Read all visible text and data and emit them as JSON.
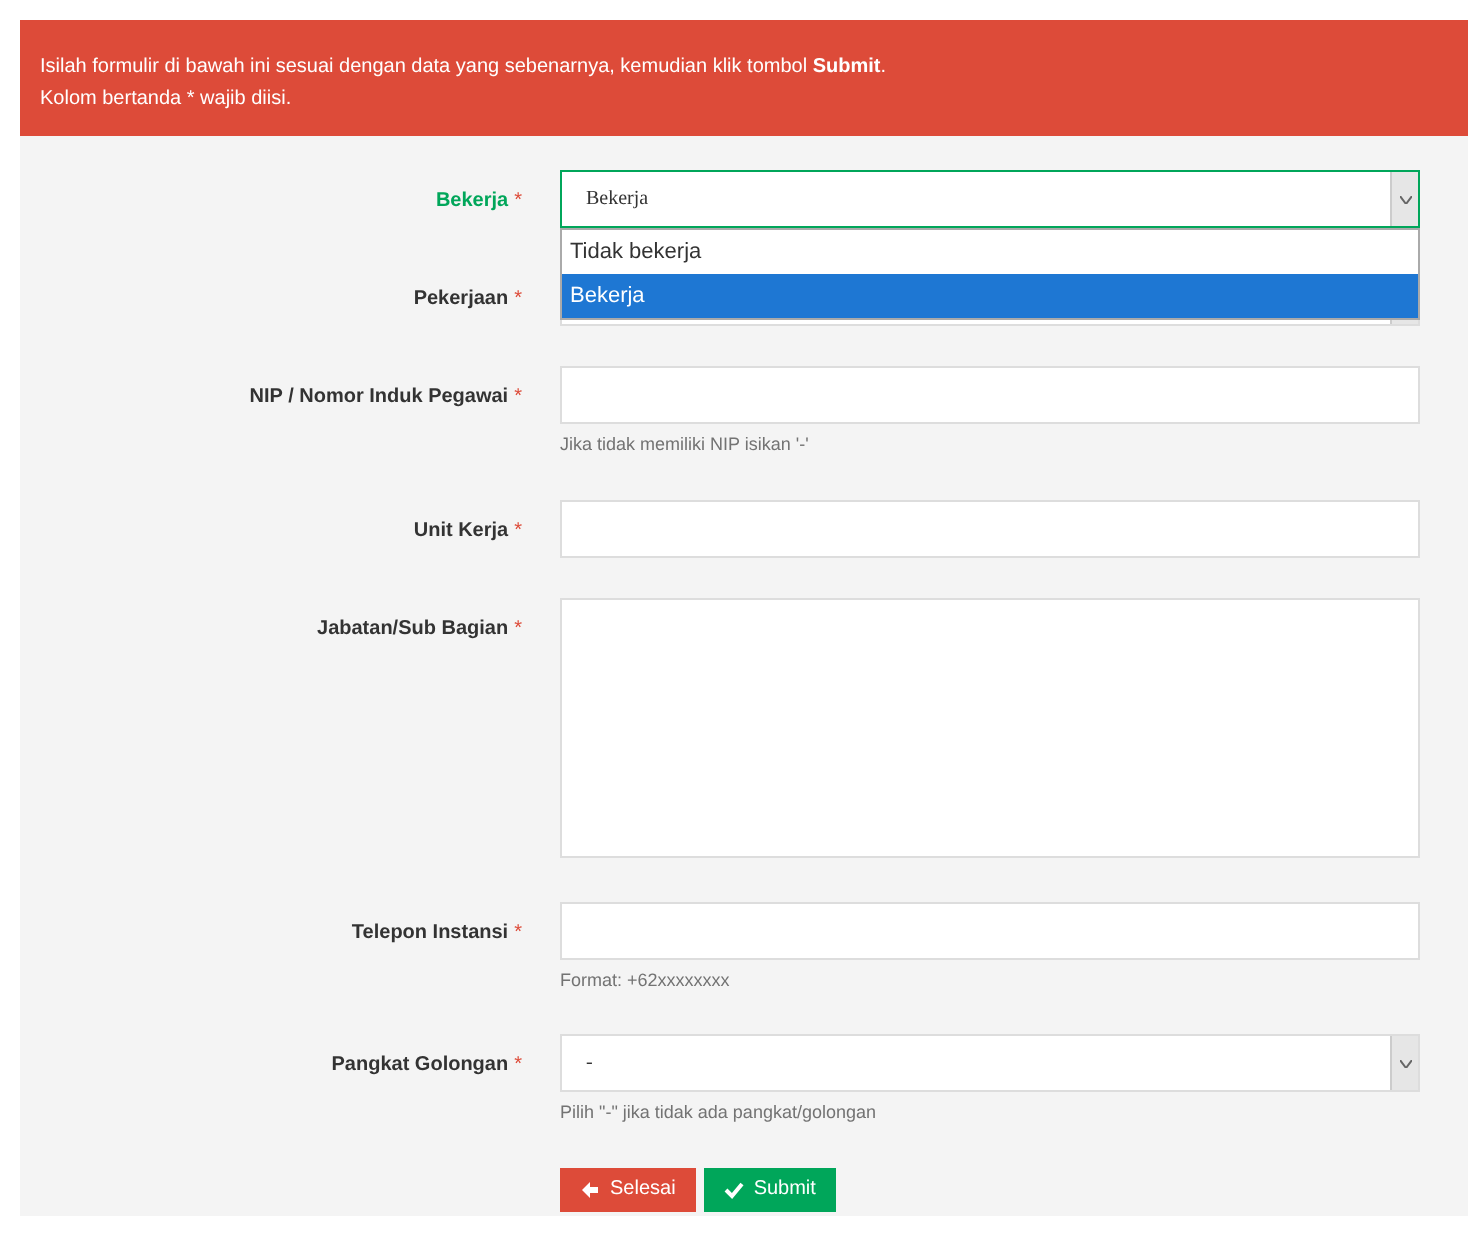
{
  "alert": {
    "lines": [
      "Isilah formulir di bawah ini sesuai dengan data yang sebenarnya, kemudian klik tombol **Submit**.",
      "Kolom bertanda * wajib diisi."
    ]
  },
  "fields": [
    {
      "kind": "select",
      "label": "Bekerja",
      "mark": "*",
      "valid": true,
      "value": "Bekerja",
      "open": true,
      "options": [
        {
          "label": "Tidak bekerja",
          "selected": false
        },
        {
          "label": "Bekerja",
          "selected": true
        }
      ]
    },
    {
      "kind": "select",
      "label": "Pekerjaan",
      "mark": "*",
      "valid": false
    },
    {
      "kind": "input",
      "label": "NIP / Nomor Induk Pegawai",
      "mark": "*",
      "valid": false,
      "help": "Jika tidak memiliki NIP isikan '-'"
    },
    {
      "kind": "input",
      "label": "Unit Kerja",
      "mark": "*",
      "valid": false
    },
    {
      "kind": "textarea",
      "label": "Jabatan/Sub Bagian",
      "mark": "*",
      "valid": false
    },
    {
      "kind": "input",
      "label": "Telepon Instansi",
      "mark": "*",
      "valid": false,
      "help": "Format: +62xxxxxxxx"
    },
    {
      "kind": "select",
      "label": "Pangkat Golongan",
      "mark": "*",
      "valid": false,
      "value": "-",
      "help": "Pilih \"-\" jika tidak ada pangkat/golongan"
    }
  ],
  "buttons": [
    {
      "kind": "back",
      "label": "Selesai"
    },
    {
      "kind": "submit",
      "label": "Submit"
    }
  ]
}
